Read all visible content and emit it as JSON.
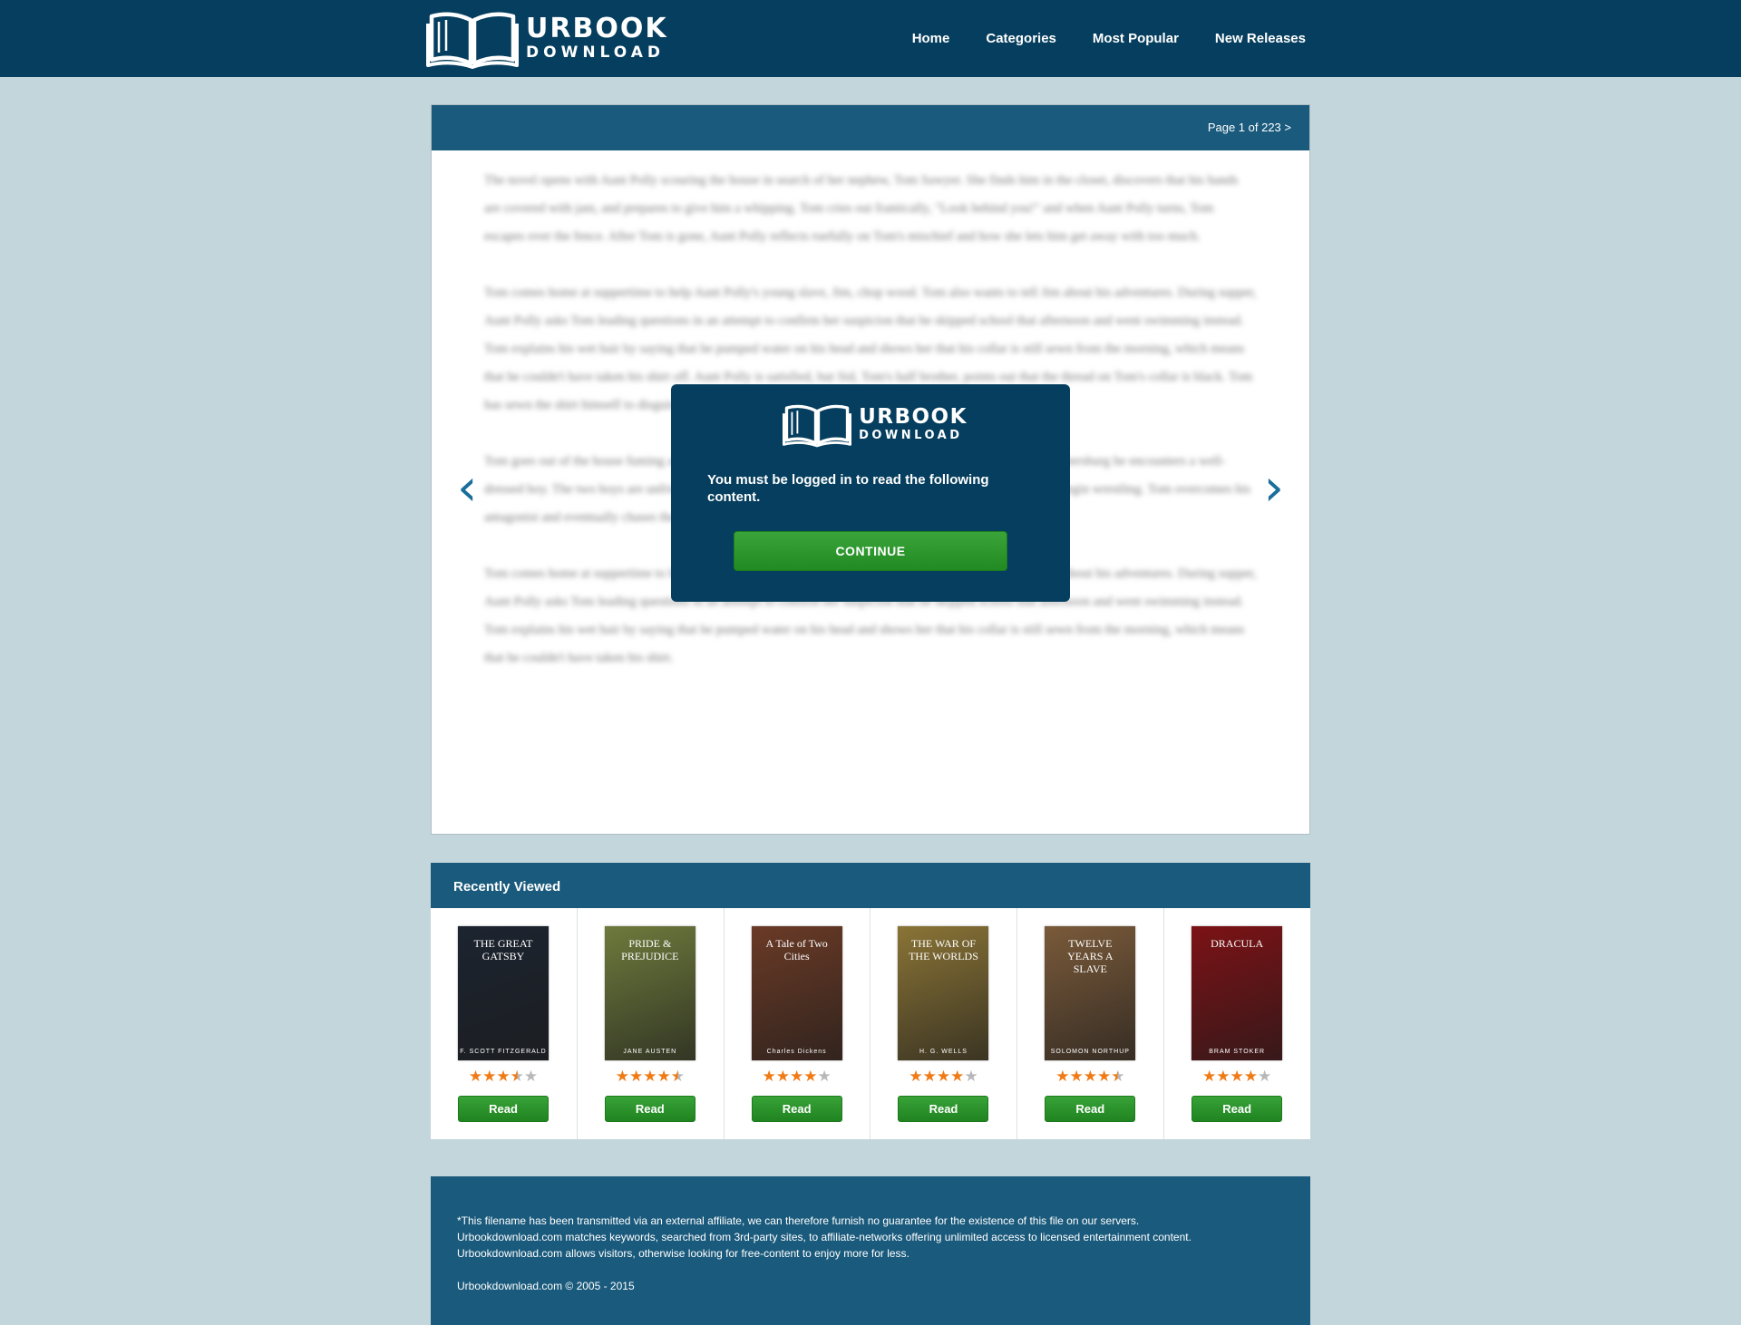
{
  "brand": {
    "line1": "URBOOK",
    "line2": "DOWNLOAD"
  },
  "nav": [
    {
      "label": "Home"
    },
    {
      "label": "Categories"
    },
    {
      "label": "Most Popular"
    },
    {
      "label": "New Releases"
    }
  ],
  "reader": {
    "page_indicator": "Page 1 of 223 >",
    "paragraphs": [
      "The novel opens with Aunt Polly scouring the house in search of her nephew, Tom Sawyer. She finds him in the closet, discovers that his hands are covered with jam, and prepares to give him a whipping. Tom cries out frantically, \"Look behind you!\" and when Aunt Polly turns, Tom escapes over the fence. After Tom is gone, Aunt Polly reflects ruefully on Tom's mischief and how she lets him get away with too much.",
      "Tom comes home at suppertime to help Aunt Polly's young slave, Jim, chop wood. Tom also wants to tell Jim about his adventures. During supper, Aunt Polly asks Tom leading questions in an attempt to confirm her suspicion that he skipped school that afternoon and went swimming instead. Tom explains his wet hair by saying that he pumped water on his head and shows her that his collar is still sewn from the morning, which means that he couldn't have taken his shirt off. Aunt Polly is satisfied, but Sid, Tom's half brother, points out that the thread on Tom's collar is black. Tom has sewn the shirt himself to disguise his deception.",
      "Tom goes out of the house fuming and practices a new style of whistling. While wandering the streets of St. Petersburg he encounters a well-dressed boy. The two boys are unfriendly and accept Tom and the new arrival exchange threats on a dare and begin wrestling. Tom overcomes his antagonist and eventually chases the newcomer all the way home.",
      "Tom comes home at suppertime to help Aunt Polly's young slave, Jim, chop wood. Tom also wants to tell Jim about his adventures. During supper, Aunt Polly asks Tom leading questions in an attempt to confirm her suspicion that he skipped school that afternoon and went swimming instead. Tom explains his wet hair by saying that he pumped water on his head and shows her that his collar is still sewn from the morning, which means that he couldn't have taken his shirt."
    ]
  },
  "modal": {
    "message": "You must be logged in to read the following content.",
    "button": "CONTINUE"
  },
  "recent": {
    "title": "Recently Viewed",
    "read_label": "Read",
    "books": [
      {
        "cover_title": "THE GREAT GATSBY",
        "cover_author": "F. SCOTT FITZGERALD",
        "rating": 3.5,
        "bg": "#1c2430"
      },
      {
        "cover_title": "PRIDE & PREJUDICE",
        "cover_author": "JANE AUSTEN",
        "rating": 4.5,
        "bg": "#6e7a3c"
      },
      {
        "cover_title": "A Tale of Two Cities",
        "cover_author": "Charles Dickens",
        "rating": 4,
        "bg": "#6a3a26"
      },
      {
        "cover_title": "THE WAR OF THE WORLDS",
        "cover_author": "H. G. WELLS",
        "rating": 4,
        "bg": "#8a7436"
      },
      {
        "cover_title": "TWELVE YEARS A SLAVE",
        "cover_author": "SOLOMON NORTHUP",
        "rating": 4.5,
        "bg": "#7a5a3a"
      },
      {
        "cover_title": "DRACULA",
        "cover_author": "BRAM STOKER",
        "rating": 4,
        "bg": "#7c1216"
      }
    ]
  },
  "footer": {
    "lines": [
      "*This filename has been transmitted via an external affiliate, we can therefore furnish no guarantee for the existence of this file on our servers.",
      "Urbookdownload.com matches keywords, searched from 3rd-party sites, to affiliate-networks offering unlimited access to licensed entertainment content.",
      "Urbookdownload.com allows visitors, otherwise looking for free-content to enjoy more for less."
    ],
    "copyright": "Urbookdownload.com © 2005 - 2015"
  },
  "icons": {
    "prev": "chevron-left-icon",
    "next": "chevron-right-icon",
    "logo": "open-book-icon",
    "star": "star-icon"
  },
  "colors": {
    "header_bg": "#053e5e",
    "panel_head": "#1a5a7c",
    "page_bg": "#c3d6dc",
    "button_green": "#2e962e",
    "star": "#f07a14"
  }
}
